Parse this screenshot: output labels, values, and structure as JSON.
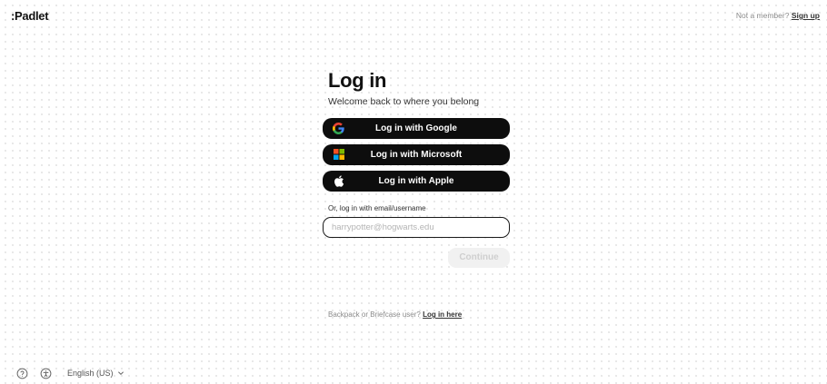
{
  "header": {
    "logo": ":Padlet",
    "not_member_text": "Not a member?",
    "signup_link": "Sign up"
  },
  "login": {
    "title": "Log in",
    "subtitle": "Welcome back to where you belong",
    "buttons": [
      {
        "label": "Log in with Google",
        "icon": "google-icon"
      },
      {
        "label": "Log in with Microsoft",
        "icon": "microsoft-icon"
      },
      {
        "label": "Log in with Apple",
        "icon": "apple-icon"
      }
    ],
    "email_label": "Or, log in with email/username",
    "email_placeholder": "harrypotter@hogwarts.edu",
    "email_value": "",
    "continue_label": "Continue"
  },
  "backpack": {
    "text": "Backpack or Briefcase user?",
    "link": "Log in here"
  },
  "footer": {
    "help_icon": "help-circle-icon",
    "accessibility_icon": "accessibility-icon",
    "language": "English (US)",
    "language_icon": "chevron-down-icon"
  },
  "colors": {
    "button_bg": "#0d0d0d",
    "button_text": "#ffffff",
    "continue_disabled_bg": "#f1f1f1",
    "continue_disabled_text": "#cfcfcf",
    "google_blue": "#4285F4",
    "google_red": "#EA4335",
    "google_yellow": "#FBBC05",
    "google_green": "#34A853",
    "ms_red": "#F25022",
    "ms_green": "#7FBA00",
    "ms_blue": "#00A4EF",
    "ms_yellow": "#FFB900"
  }
}
